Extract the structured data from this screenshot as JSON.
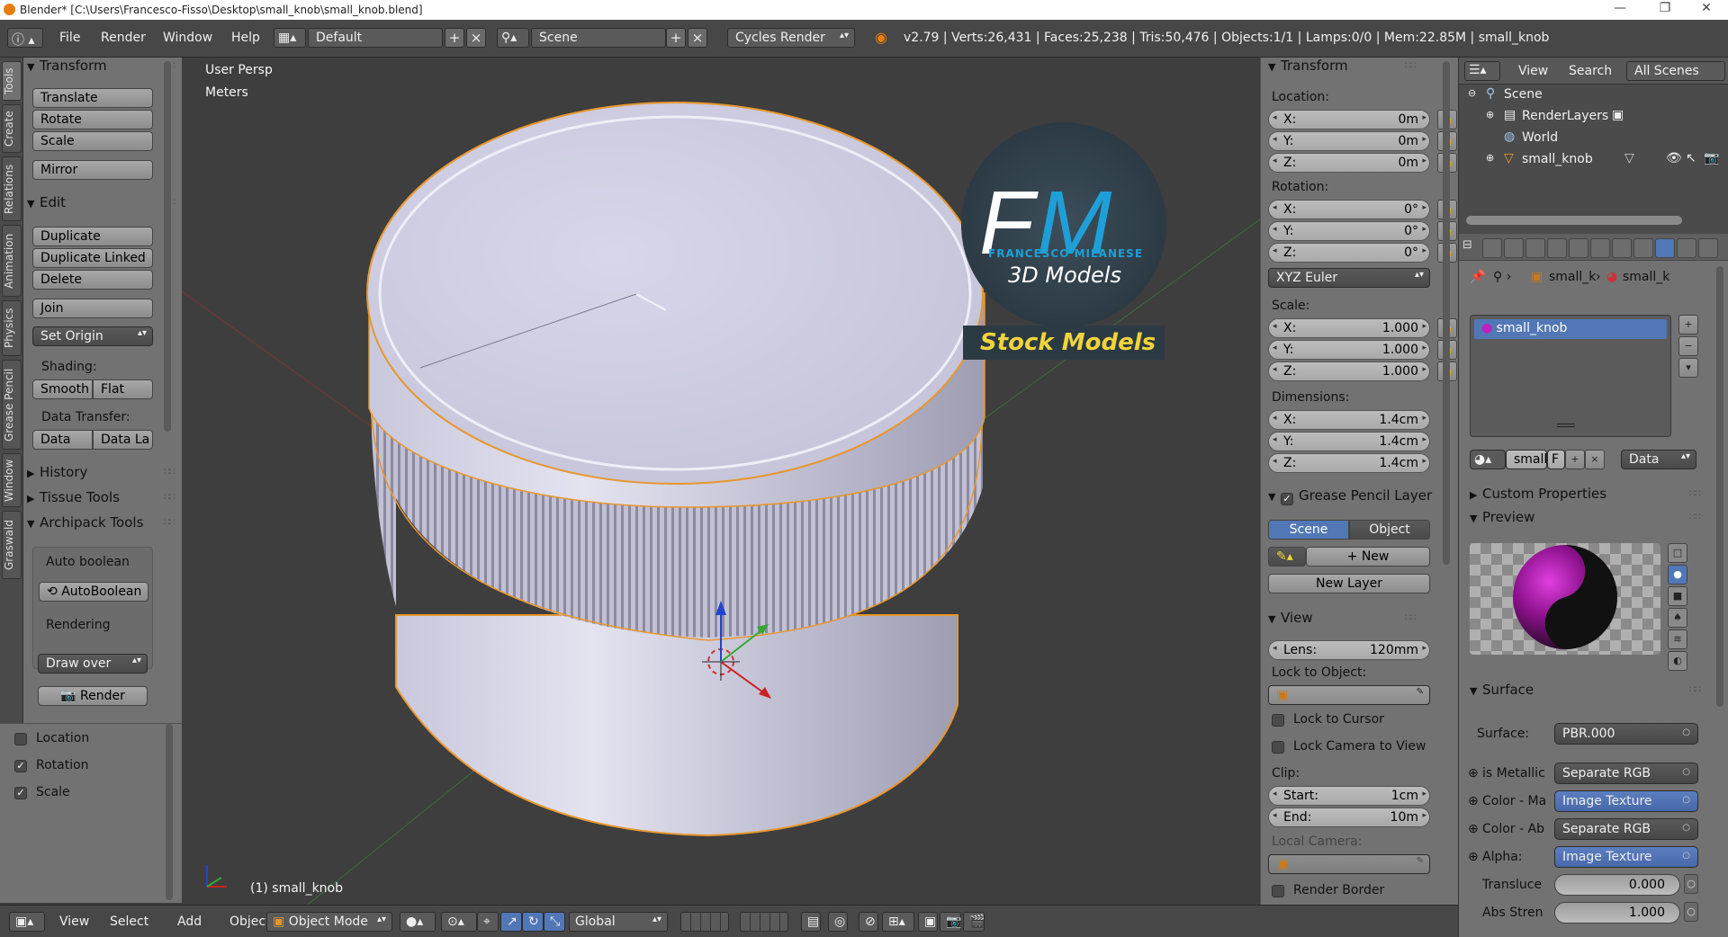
{
  "window": {
    "title": "Blender* [C:\\Users\\Francesco-Fisso\\Desktop\\small_knob\\small_knob.blend]",
    "minimize": "—",
    "maximize": "❐",
    "close": "✕"
  },
  "infobar": {
    "menus": [
      "File",
      "Render",
      "Window",
      "Help"
    ],
    "screen_layout": "Default",
    "scene": "Scene",
    "render_engine": "Cycles Render",
    "stats": "v2.79 | Verts:26,431 | Faces:25,238 | Tris:50,476 | Objects:1/1 | Lamps:0/0 | Mem:22.85M | small_knob"
  },
  "tool_tabs": [
    "Tools",
    "Create",
    "Relations",
    "Animation",
    "Physics",
    "Grease Pencil",
    "Window",
    "Graswald"
  ],
  "toolshelf": {
    "transform": {
      "title": "Transform",
      "buttons": [
        "Translate",
        "Rotate",
        "Scale",
        "Mirror"
      ]
    },
    "edit": {
      "title": "Edit",
      "buttons": [
        "Duplicate",
        "Duplicate Linked",
        "Delete",
        "Join"
      ],
      "set_origin": "Set Origin",
      "shading_label": "Shading:",
      "smooth": "Smooth",
      "flat": "Flat",
      "data_transfer_label": "Data Transfer:",
      "data": "Data",
      "data_la": "Data La"
    },
    "history": "History",
    "tissue": "Tissue Tools",
    "archipack": {
      "title": "Archipack Tools",
      "auto_boolean_label": "Auto boolean",
      "auto_boolean_btn": "AutoBoolean",
      "rendering_label": "Rendering",
      "draw_over": "Draw over",
      "render_btn": "Render"
    }
  },
  "last_operator": {
    "location": "Location",
    "rotation": "Rotation",
    "scale": "Scale"
  },
  "viewport": {
    "view_name": "User Persp",
    "units": "Meters",
    "object_label": "(1) small_knob",
    "watermark": {
      "fm": "FM",
      "name": "FRANCESCO MILANESE",
      "sub": "3D Models",
      "banner": "Stock Models"
    }
  },
  "npanel": {
    "transform_title": "Transform",
    "location_label": "Location:",
    "location": {
      "x": "0m",
      "y": "0m",
      "z": "0m"
    },
    "rotation_label": "Rotation:",
    "rotation": {
      "x": "0°",
      "y": "0°",
      "z": "0°"
    },
    "rotation_mode": "XYZ Euler",
    "scale_label": "Scale:",
    "scale": {
      "x": "1.000",
      "y": "1.000",
      "z": "1.000"
    },
    "dimensions_label": "Dimensions:",
    "dimensions": {
      "x": "1.4cm",
      "y": "1.4cm",
      "z": "1.4cm"
    },
    "axis": {
      "x": "X:",
      "y": "Y:",
      "z": "Z:"
    },
    "gp_layer_title": "Grease Pencil Layer",
    "gp_scene": "Scene",
    "gp_object": "Object",
    "gp_new": "New",
    "gp_new_layer": "New Layer",
    "view_title": "View",
    "lens_label": "Lens:",
    "lens": "120mm",
    "lock_to_object": "Lock to Object:",
    "lock_to_cursor": "Lock to Cursor",
    "lock_camera": "Lock Camera to View",
    "clip_label": "Clip:",
    "clip_start_label": "Start:",
    "clip_start": "1cm",
    "clip_end_label": "End:",
    "clip_end": "10m",
    "local_camera": "Local Camera:",
    "render_border": "Render Border"
  },
  "outliner": {
    "view": "View",
    "search": "Search",
    "all_scenes": "All Scenes",
    "items": [
      "Scene",
      "RenderLayers",
      "World",
      "small_knob"
    ]
  },
  "properties": {
    "breadcrumb": [
      "small_k",
      "small_k"
    ],
    "material_slot": "small_knob",
    "mat_name": "small",
    "mat_f": "F",
    "mat_link": "Data",
    "custom_props": "Custom Properties",
    "preview": "Preview",
    "surface_title": "Surface",
    "surface_label": "Surface:",
    "surface_value": "PBR.000",
    "inputs": [
      {
        "label": "is Metallic",
        "value": "Separate RGB",
        "blue": false
      },
      {
        "label": "Color - Ma",
        "value": "Image Texture",
        "blue": true
      },
      {
        "label": "Color - Ab",
        "value": "Separate RGB",
        "blue": false
      },
      {
        "label": "Alpha:",
        "value": "Image Texture",
        "blue": true
      }
    ],
    "translucence_label": "Transluce",
    "translucence": "0.000",
    "abs_label": "Abs Stren",
    "abs": "1.000"
  },
  "bottombar": {
    "menus": [
      "View",
      "Select",
      "Add",
      "Object"
    ],
    "mode": "Object Mode",
    "orientation": "Global"
  },
  "colors": {
    "accent": "#5277b6",
    "selection_outline": "#e8972d",
    "brand_blue": "#1f9fd8",
    "banner_yellow": "#f0d43a"
  }
}
